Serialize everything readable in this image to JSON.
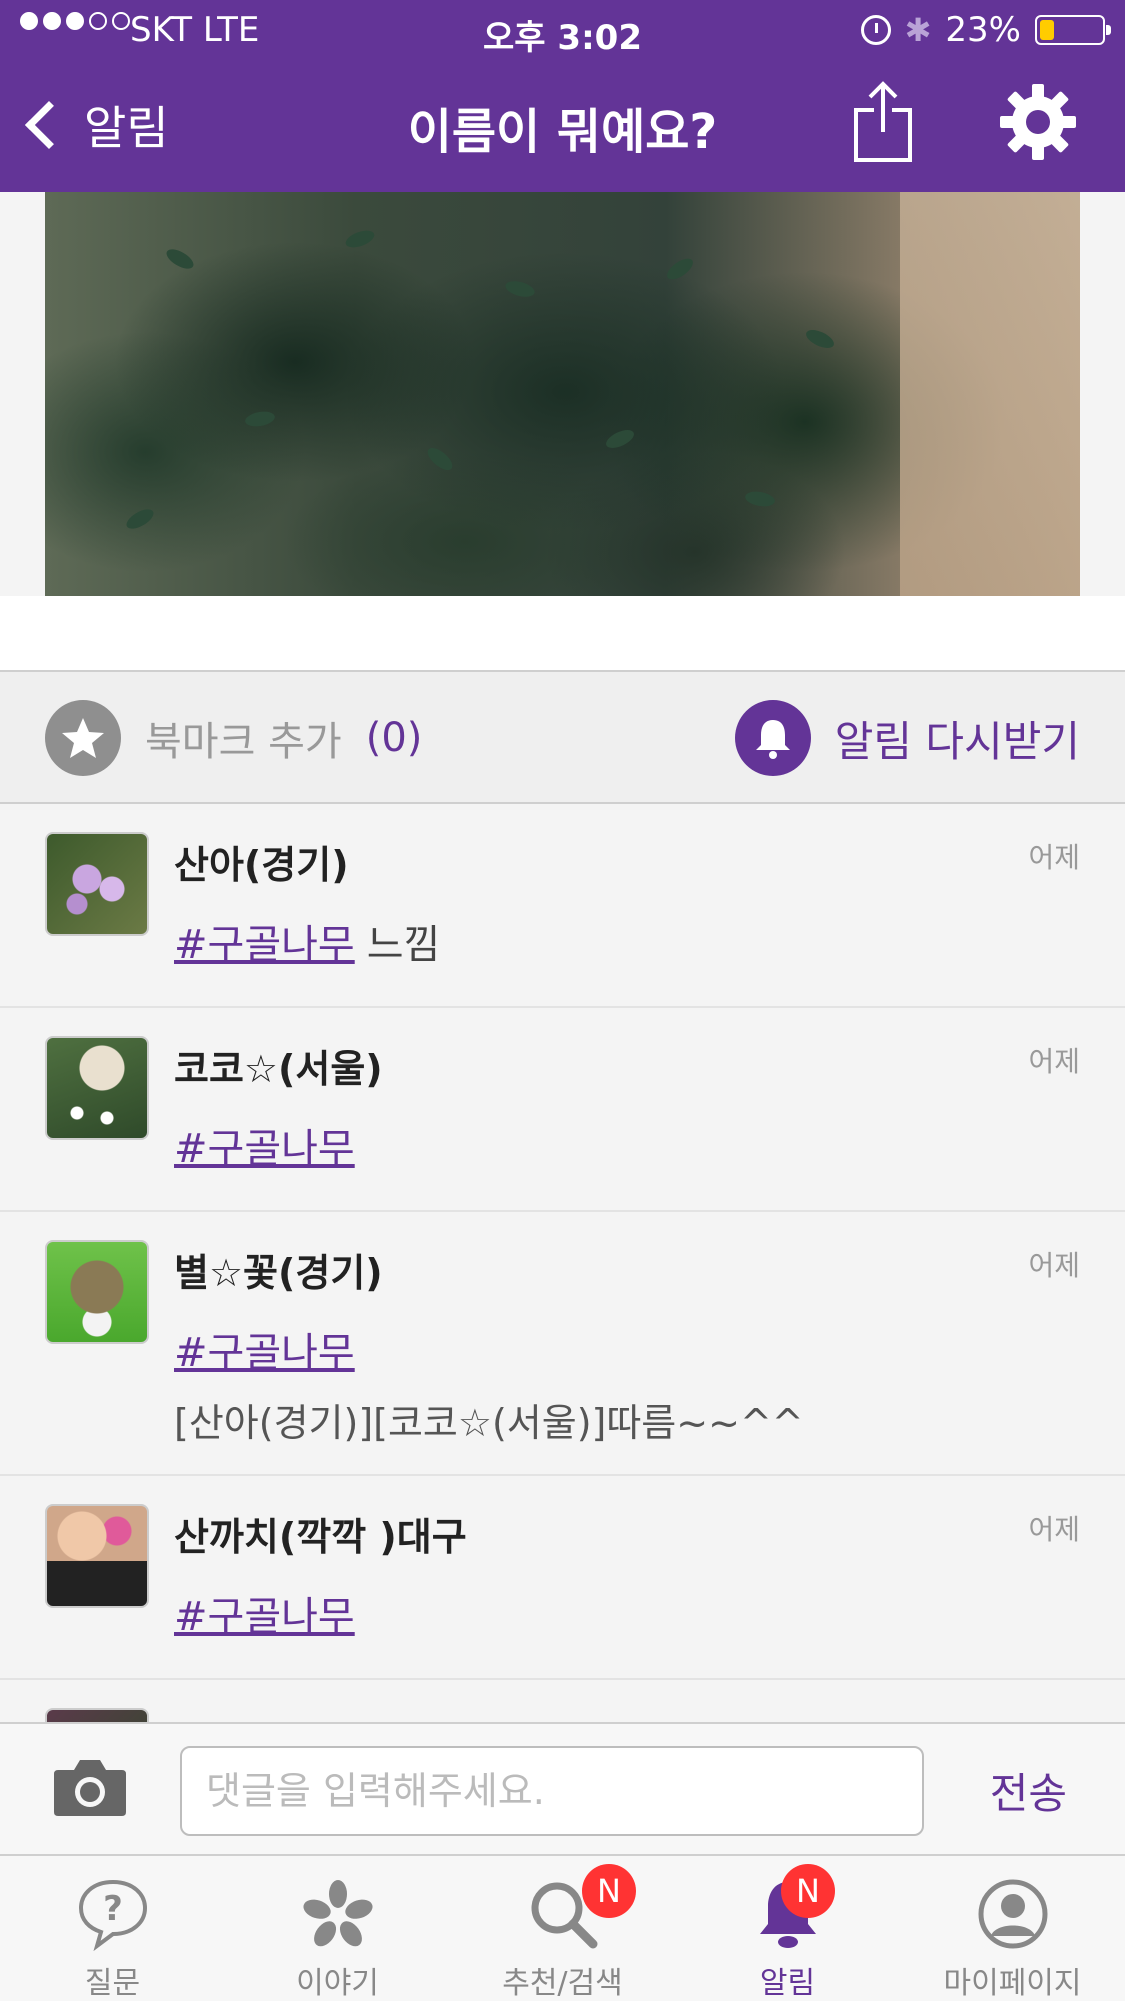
{
  "status_bar": {
    "carrier": "SKT   LTE",
    "time": "오후 3:02",
    "battery_text": "23%",
    "battery_level": 0.23
  },
  "nav": {
    "back_label": "알림",
    "title": "이름이 뭐예요?"
  },
  "actions": {
    "bookmark_label": "북마크 추가",
    "bookmark_count": "(0)",
    "alarm_again_label": "알림 다시받기"
  },
  "comments": [
    {
      "name": "산아(경기)",
      "time": "어제",
      "tag": "#구골나무",
      "tag_rest": "느낌",
      "extra": ""
    },
    {
      "name": "코코☆(서울)",
      "time": "어제",
      "tag": "#구골나무",
      "tag_rest": "",
      "extra": ""
    },
    {
      "name": "별☆꽃(경기)",
      "time": "어제",
      "tag": "#구골나무",
      "tag_rest": "",
      "extra": "[산아(경기)][코코☆(서울)]따름~~^^"
    },
    {
      "name": "산까치(깍깍 )대구",
      "time": "어제",
      "tag": "#구골나무",
      "tag_rest": "",
      "extra": ""
    }
  ],
  "input": {
    "placeholder": "댓글을 입력해주세요.",
    "send_label": "전송"
  },
  "tabs": [
    {
      "label": "질문",
      "icon": "question-icon",
      "badge": ""
    },
    {
      "label": "이야기",
      "icon": "flower-icon",
      "badge": ""
    },
    {
      "label": "추천/검색",
      "icon": "search-icon",
      "badge": "N"
    },
    {
      "label": "알림",
      "icon": "bell-icon",
      "badge": "N"
    },
    {
      "label": "마이페이지",
      "icon": "profile-icon",
      "badge": ""
    }
  ],
  "colors": {
    "brand": "#633497",
    "badge": "#ff3333",
    "battery": "#ffcc00"
  }
}
